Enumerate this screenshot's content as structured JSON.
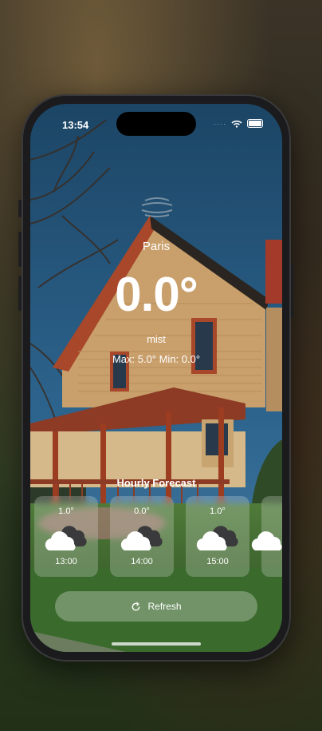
{
  "status_bar": {
    "time": "13:54",
    "signal": "····"
  },
  "weather": {
    "city": "Paris",
    "temperature": "0.0°",
    "condition": "mist",
    "max_min": "Max: 5.0° Min: 0.0°"
  },
  "hourly": {
    "title": "Hourly Forecast",
    "items": [
      {
        "temp": "1.0°",
        "time": "13:00",
        "icon": "cloud-icon"
      },
      {
        "temp": "0.0°",
        "time": "14:00",
        "icon": "cloud-icon"
      },
      {
        "temp": "1.0°",
        "time": "15:00",
        "icon": "cloud-icon"
      },
      {
        "temp": "",
        "time": "",
        "icon": "cloud-icon"
      }
    ]
  },
  "actions": {
    "refresh_label": "Refresh"
  },
  "colors": {
    "sky": "#27557a",
    "house_siding": "#c79a66",
    "trim": "#a8472a",
    "grass": "#3d6b2e"
  }
}
